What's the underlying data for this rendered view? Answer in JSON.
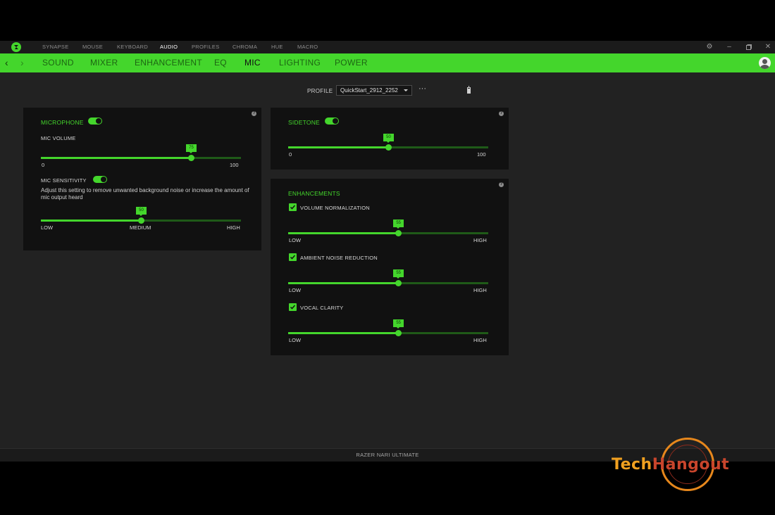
{
  "topnav": {
    "items": [
      "SYNAPSE",
      "MOUSE",
      "KEYBOARD",
      "AUDIO",
      "PROFILES",
      "CHROMA",
      "HUE",
      "MACRO"
    ],
    "active": "AUDIO"
  },
  "subnav": {
    "items": [
      "SOUND",
      "MIXER",
      "ENHANCEMENT",
      "EQ",
      "MIC",
      "LIGHTING",
      "POWER"
    ],
    "active": "MIC"
  },
  "profile": {
    "label": "PROFILE",
    "value": "QuickStart_2912_2252",
    "more": "···"
  },
  "mic_panel": {
    "microphone_title": "MICROPHONE",
    "microphone_enabled": true,
    "mic_volume_label": "MIC VOLUME",
    "mic_volume": 75,
    "mic_volume_value_text": "75",
    "mic_volume_min": "0",
    "mic_volume_max": "100",
    "sensitivity_label": "MIC SENSITIVITY",
    "sensitivity_enabled": true,
    "sensitivity_desc": "Adjust this setting to remove unwanted background noise or increase the amount of mic output heard",
    "sensitivity": 50,
    "sensitivity_value_text": "50",
    "sensitivity_low": "LOW",
    "sensitivity_mid": "MEDIUM",
    "sensitivity_high": "HIGH"
  },
  "sidetone_panel": {
    "title": "SIDETONE",
    "enabled": true,
    "value": 50,
    "value_text": "50",
    "min": "0",
    "max": "100"
  },
  "enhancements_panel": {
    "title": "ENHANCEMENTS",
    "items": [
      {
        "label": "VOLUME NORMALIZATION",
        "checked": true,
        "value": 55,
        "value_text": "55",
        "low": "LOW",
        "high": "HIGH"
      },
      {
        "label": "AMBIENT NOISE REDUCTION",
        "checked": true,
        "value": 55,
        "value_text": "55",
        "low": "LOW",
        "high": "HIGH"
      },
      {
        "label": "VOCAL CLARITY",
        "checked": true,
        "value": 55,
        "value_text": "55",
        "low": "LOW",
        "high": "HIGH"
      }
    ]
  },
  "footer": {
    "device": "RAZER NARI ULTIMATE"
  },
  "watermark": {
    "part1": "Tech",
    "part2": "Hangout"
  },
  "colors": {
    "accent": "#44d62c",
    "background": "#222222",
    "panel": "#111111"
  }
}
